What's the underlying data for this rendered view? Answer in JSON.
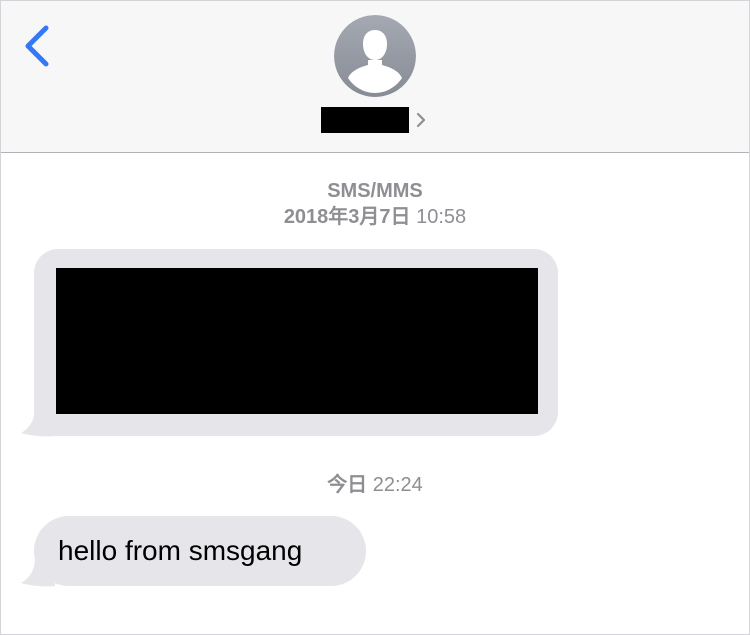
{
  "header": {
    "back_icon": "chevron-left-icon",
    "avatar_icon": "person-silhouette-icon",
    "contact_chevron_icon": "chevron-right-icon"
  },
  "thread": {
    "service_label": "SMS/MMS",
    "first_timestamp": {
      "date": "2018年3月7日",
      "time": "10:58"
    },
    "second_timestamp": {
      "day": "今日",
      "time": "22:24"
    },
    "messages": [
      {
        "direction": "incoming",
        "redacted": true
      },
      {
        "direction": "incoming",
        "text": "hello from smsgang"
      }
    ]
  },
  "colors": {
    "accent": "#3478f6",
    "header_bg": "#f7f7f7",
    "bubble_incoming": "#e5e5ea",
    "meta_text": "#8e8e93",
    "avatar_gradient_top": "#a5a9b2",
    "avatar_gradient_bottom": "#878b95"
  }
}
